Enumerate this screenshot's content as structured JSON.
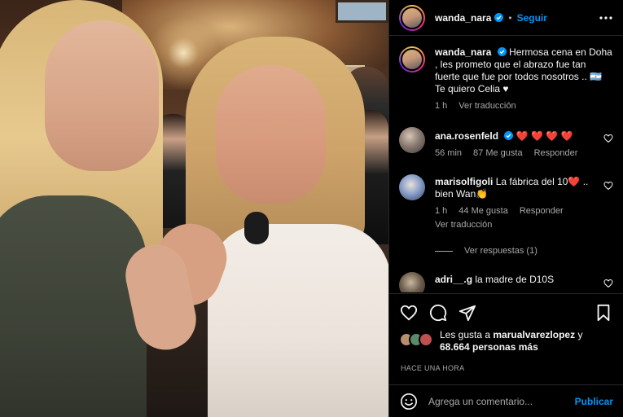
{
  "post": {
    "username": "wanda_nara",
    "follow_label": "Seguir",
    "dot": "•",
    "caption": "Hermosa cena en Doha , les prometo que el abrazo fue tan fuerte que fue por todos nosotros .. 🇦🇷 Te quiero Celia ♥",
    "caption_time": "1 h",
    "caption_translate": "Ver traducción"
  },
  "comments": [
    {
      "username": "ana.rosenfeld",
      "text": "❤️ ❤️ ❤️ ❤️",
      "time": "56 min",
      "likes": "87 Me gusta",
      "reply": "Responder"
    },
    {
      "username": "marisolfigoli",
      "text": "La fábrica del 10❤️ .. bien Wan👏",
      "time": "1 h",
      "likes": "44 Me gusta",
      "reply": "Responder",
      "translate": "Ver traducción",
      "view_replies": "Ver respuestas (1)"
    },
    {
      "username": "adri__.g",
      "text": "la madre de D10S"
    }
  ],
  "likes": {
    "prefix": "Les gusta a ",
    "user": "marualvarezlopez",
    "middle": " y ",
    "count": "68.664 personas más"
  },
  "timestamp": "HACE UNA HORA",
  "composer": {
    "placeholder": "Agrega un comentario...",
    "publish_label": "Publicar"
  },
  "icons": {
    "more": "more-options-icon",
    "heart": "heart-icon",
    "comment": "comment-icon",
    "share": "share-icon",
    "save": "bookmark-icon",
    "emoji": "emoji-icon",
    "verified": "verified-badge-icon"
  },
  "colors": {
    "accent": "#0095f6",
    "like_red": "#ed4956",
    "background": "#000000"
  }
}
